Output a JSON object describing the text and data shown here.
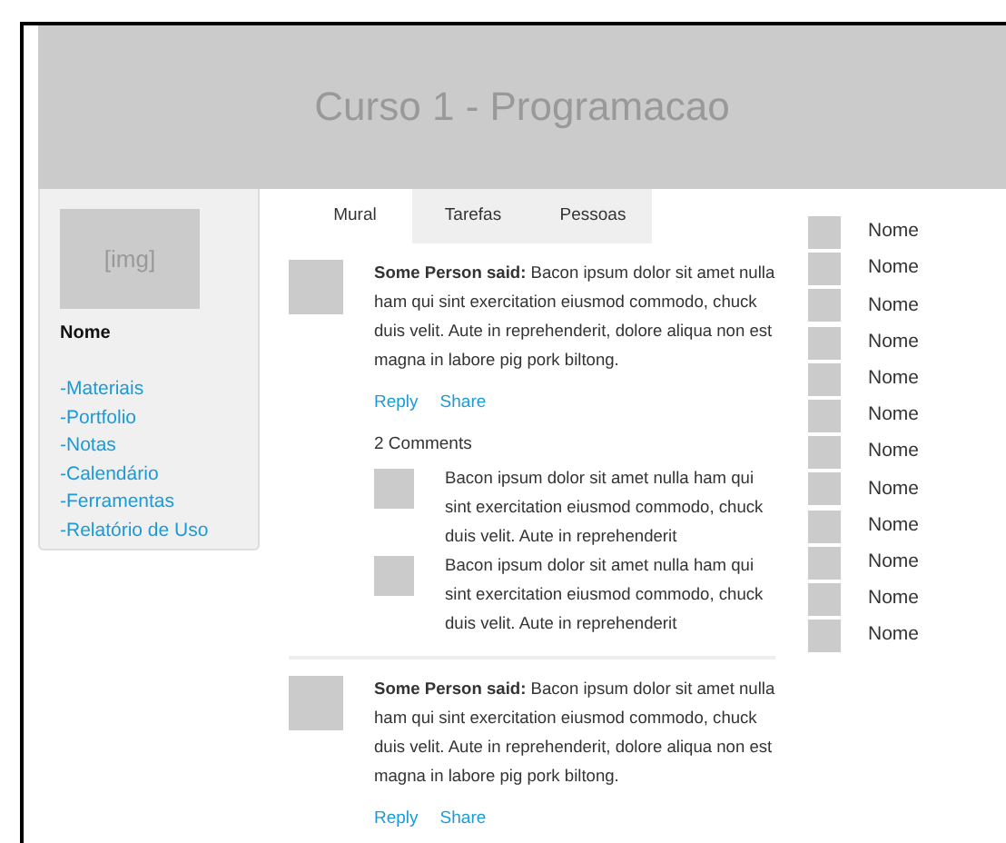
{
  "header": {
    "title": "Curso 1 - Programacao"
  },
  "sidebar": {
    "image_label": "[img]",
    "name": "Nome",
    "links": [
      "-Materiais",
      "-Portfolio",
      "-Notas",
      "-Calendário",
      "-Ferramentas",
      "-Relatório de Uso"
    ]
  },
  "tabs": [
    {
      "label": "Mural",
      "selected": true
    },
    {
      "label": "Tarefas",
      "selected": false
    },
    {
      "label": "Pessoas",
      "selected": false
    }
  ],
  "posts": [
    {
      "text": "**Some Person said:** Bacon ipsum dolor sit amet nulla ham qui sint exercitation eiusmod commodo, chuck duis velit. Aute in reprehenderit, dolore aliqua non est magna in labore pig pork biltong.",
      "actions": [
        "Reply",
        "Share"
      ],
      "comment_count": "2 Comments",
      "comments": [
        {
          "text": "Bacon ipsum dolor sit amet nulla ham qui sint exercitation eiusmod commodo, chuck duis velit. Aute in reprehenderit"
        },
        {
          "text": "Bacon ipsum dolor sit amet nulla ham qui sint exercitation eiusmod commodo, chuck duis velit. Aute in reprehenderit"
        }
      ]
    },
    {
      "text": "**Some Person said:** Bacon ipsum dolor sit amet nulla ham qui sint exercitation eiusmod commodo, chuck duis velit. Aute in reprehenderit, dolore aliqua non est magna in labore pig pork biltong.",
      "actions": [
        "Reply",
        "Share"
      ]
    }
  ],
  "people": [
    {
      "name": "Nome"
    },
    {
      "name": "Nome"
    },
    {
      "name": "Nome"
    },
    {
      "name": "Nome"
    },
    {
      "name": "Nome"
    },
    {
      "name": "Nome"
    },
    {
      "name": "Nome"
    },
    {
      "name": "Nome"
    },
    {
      "name": "Nome"
    },
    {
      "name": "Nome"
    },
    {
      "name": "Nome"
    },
    {
      "name": "Nome"
    }
  ]
}
